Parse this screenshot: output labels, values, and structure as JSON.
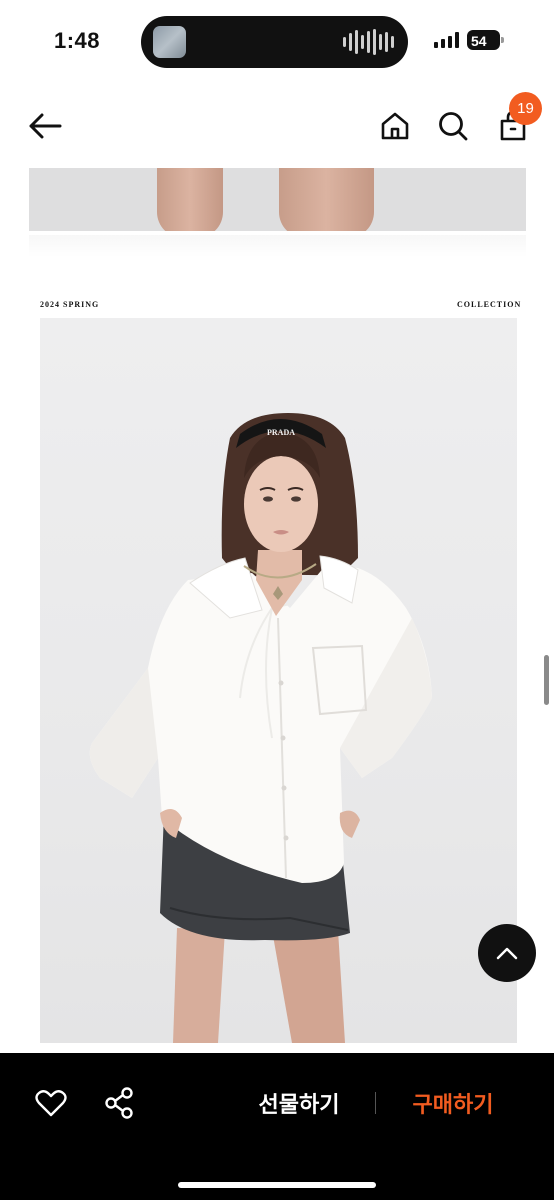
{
  "status_bar": {
    "time": "1:48",
    "battery_level": "54"
  },
  "header": {
    "back_icon": "arrow-left-icon",
    "home_icon": "home-icon",
    "search_icon": "search-icon",
    "bag_icon": "shopping-bag-icon",
    "bag_count": "19",
    "badge_color": "#f25c20"
  },
  "collection": {
    "season": "2024 SPRING",
    "label": "COLLECTION",
    "headband_text": "PRADA"
  },
  "bottom_bar": {
    "like_icon": "heart-icon",
    "share_icon": "share-icon",
    "gift_label": "선물하기",
    "buy_label": "구매하기",
    "buy_color": "#f25c20"
  },
  "scroll_top_icon": "chevron-up-icon"
}
